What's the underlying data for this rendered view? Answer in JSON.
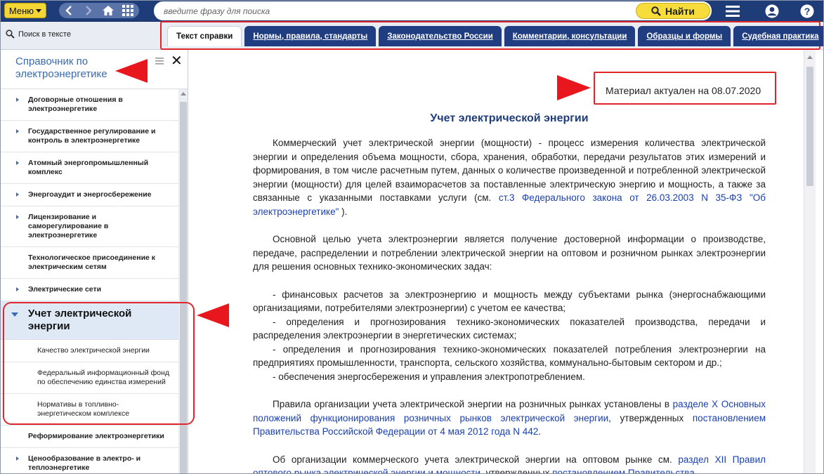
{
  "topbar": {
    "menu_label": "Меню",
    "search_placeholder": "введите фразу для поиска",
    "find_label": "Найти",
    "icons": [
      "back-icon",
      "forward-icon",
      "home-icon",
      "grid-icon",
      "search-icon",
      "hamburger-icon",
      "user-icon",
      "question-icon"
    ]
  },
  "subbar": {
    "search_in_text": "Поиск в тексте",
    "tabs": [
      {
        "label": "Текст справки",
        "active": true
      },
      {
        "label": "Нормы, правила, стандарты",
        "active": false
      },
      {
        "label": "Законодательство России",
        "active": false
      },
      {
        "label": "Комментарии, консультации",
        "active": false
      },
      {
        "label": "Образцы и формы",
        "active": false
      },
      {
        "label": "Судебная практика",
        "active": false
      }
    ]
  },
  "sidebar": {
    "title": "Справочник по электроэнергетике",
    "items_before": [
      {
        "label": "Договорные отношения в электроэнергетике",
        "has_children": true
      },
      {
        "label": "Государственное регулирование и контроль в электроэнергетике",
        "has_children": true
      },
      {
        "label": "Атомный энергопромышленный комплекс",
        "has_children": true
      },
      {
        "label": "Энергоаудит и энергосбережение",
        "has_children": true
      },
      {
        "label": "Лицензирование и саморегулирование в электроэнергетике",
        "has_children": true
      },
      {
        "label": "Технологическое присоединение к электрическим сетям",
        "has_children": false
      },
      {
        "label": "Электрические сети",
        "has_children": true
      }
    ],
    "current": {
      "label": "Учет электрической энергии",
      "children": [
        "Качество электрической энергии",
        "Федеральный информационный фонд по обеспечению единства измерений",
        "Нормативы в топливно-энергетическом комплексе"
      ]
    },
    "items_after": [
      {
        "label": "Реформирование электроэнергетики",
        "has_children": false
      },
      {
        "label": "Ценообразование в электро- и теплоэнергетике",
        "has_children": true
      }
    ]
  },
  "document": {
    "actual_date": "Материал актуален на 08.07.2020",
    "title": "Учет электрической энергии",
    "p1_text": "Коммерческий учет электрической энергии (мощности) - процесс измерения количества электрической энергии и определения объема мощности, сбора, хранения, обработки, передачи результатов этих измерений и формирования, в том числе расчетным путем, данных о количестве произведенной и потребленной электрической энергии (мощности) для целей взаиморасчетов за поставленные электрическую энергию и мощность, а также за связанные с указанными поставками услуги (см. ",
    "p1_link": "ст.3 Федерального закона от 26.03.2003 N 35-ФЗ \"Об электроэнергетике\"",
    "p1_end": " ).",
    "p2": "Основной целью учета электроэнергии является получение достоверной информации о производстве, передаче, распределении и потреблении электрической энергии на оптовом и розничном рынках электроэнергии для решения основных технико-экономических задач:",
    "list": [
      "- финансовых расчетов за электроэнергию и мощность между субъектами рынка (энергоснабжающими организациями, потребителями электроэнергии) с учетом ее качества;",
      "- определения и прогнозирования технико-экономических показателей производства, передачи и распределения электроэнергии в энергетических системах;",
      "- определения и прогнозирования технико-экономических показателей потребления электроэнергии на предприятиях промышленности, транспорта, сельского хозяйства, коммунально-бытовым сектором и др.;",
      "- обеспечения энергосбережения и управления электропотреблением."
    ],
    "p3_text": "Правила организации учета электрической энергии на розничных рынках установлены в ",
    "p3_link1": "разделе X Основных положений функционирования розничных рынков электрической энергии",
    "p3_mid": ", утвержденных ",
    "p3_link2": "постановлением Правительства Российской Федерации от 4 мая 2012 года N 442",
    "p3_end": ".",
    "p4_text": "Об организации коммерческого учета электрической энергии на оптовом рынке см. ",
    "p4_link1": "раздел XII Правил оптового рынка электрической энергии и мощности",
    "p4_mid": ", утвержденных ",
    "p4_link2": "постановлением Правительства"
  },
  "colors": {
    "topbar": "#1e3c78",
    "accent_yellow": "#f4d635",
    "tab_bg": "#1f3d80",
    "link": "#1a3fb0",
    "annotation_red": "#e8161d"
  }
}
